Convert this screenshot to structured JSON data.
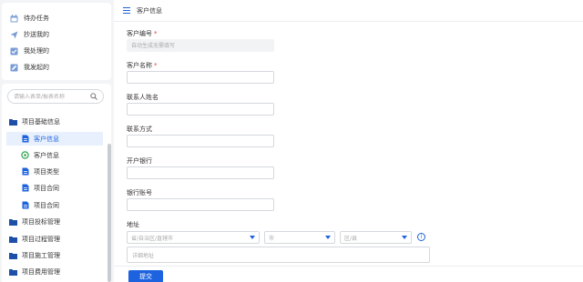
{
  "quick_links": [
    {
      "label": "待办任务",
      "icon": "calendar-icon"
    },
    {
      "label": "抄送我的",
      "icon": "send-icon"
    },
    {
      "label": "我处理的",
      "icon": "task-icon"
    },
    {
      "label": "我发起的",
      "icon": "edit-icon"
    }
  ],
  "search": {
    "placeholder": "请输入表单/报表名称"
  },
  "tree": [
    {
      "label": "项目基础信息",
      "icon": "folder-icon",
      "level": 0
    },
    {
      "label": "客户信息",
      "icon": "form-icon",
      "level": 1,
      "active": true
    },
    {
      "label": "客户信息",
      "icon": "report-icon",
      "level": 1
    },
    {
      "label": "项目类型",
      "icon": "form-icon",
      "level": 1
    },
    {
      "label": "项目合同",
      "icon": "form-icon",
      "level": 1
    },
    {
      "label": "项目合同",
      "icon": "report-icon",
      "level": 1
    },
    {
      "label": "项目投标管理",
      "icon": "folder-icon",
      "level": 0
    },
    {
      "label": "项目过程管理",
      "icon": "folder-icon",
      "level": 0
    },
    {
      "label": "项目施工管理",
      "icon": "folder-icon",
      "level": 0
    },
    {
      "label": "项目费用管理",
      "icon": "folder-icon",
      "level": 0
    }
  ],
  "header": {
    "title": "客户信息"
  },
  "form": {
    "customer_no": {
      "label": "客户编号",
      "required": "*",
      "value": "自动生成无需填写"
    },
    "customer_name": {
      "label": "客户名称",
      "required": "*",
      "value": ""
    },
    "contact_name": {
      "label": "联系人姓名",
      "value": ""
    },
    "contact": {
      "label": "联系方式",
      "value": ""
    },
    "bank": {
      "label": "开户银行",
      "value": ""
    },
    "account": {
      "label": "银行账号",
      "value": ""
    },
    "address": {
      "label": "地址",
      "province_placeholder": "省/自治区/直辖市",
      "city_placeholder": "市",
      "district_placeholder": "区/县",
      "detail_placeholder": "详细地址"
    }
  },
  "actions": {
    "submit_label": "提交"
  },
  "colors": {
    "accent": "#1d63e0",
    "active_bg": "#e8f0fd",
    "required": "#e53935"
  }
}
